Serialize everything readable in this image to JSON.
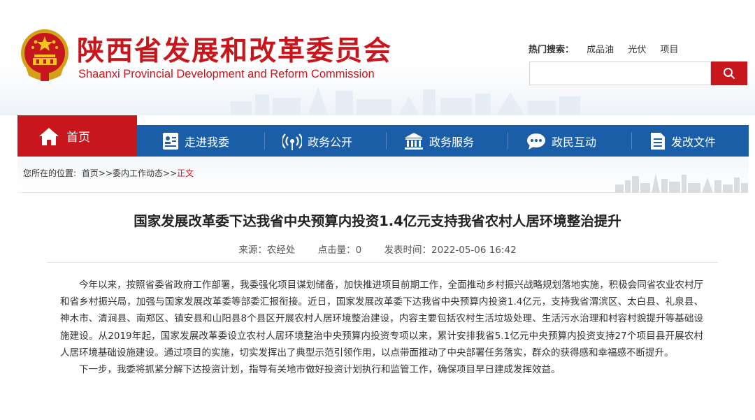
{
  "header": {
    "title_cn": "陕西省发展和改革委员会",
    "title_en": "Shaanxi Provincial Development and Reform Commission",
    "hot_search_label": "热门搜索：",
    "hot_search_items": [
      "成品油",
      "光伏",
      "项目"
    ],
    "search_placeholder": ""
  },
  "nav": {
    "home": "首页",
    "items": [
      "走进我委",
      "政务公开",
      "政务服务",
      "政民互动",
      "发改文件"
    ]
  },
  "breadcrumb": {
    "prefix": "您所在的位置:",
    "home": "首页",
    "sep1": ">>",
    "section": "委内工作动态",
    "sep2": ">>",
    "current": "正文"
  },
  "article": {
    "title": "国家发展改革委下达我省中央预算内投资1.4亿元支持我省农村人居环境整治提升",
    "source": "来源：农经处",
    "clicks": "点击量：0",
    "published": "发表时间：2022-05-06 16:42",
    "paragraphs": [
      "今年以来，按照省委省政府工作部署，我委强化项目谋划储备，加快推进项目前期工作，全面推动乡村振兴战略规划落地实施，积极会同省农业农村厅和省乡村振兴局，加强与国家发展改革委等部委汇报衔接。近日，国家发展改革委下达我省中央预算内投资1.4亿元，支持我省渭滨区、太白县、礼泉县、神木市、清涧县、南郑区、镇安县和山阳县8个县区开展农村人居环境整治建设，内容主要包括农村生活垃圾处理、生活污水治理和村容村貌提升等基础设施建设。从2019年起，国家发展改革委设立农村人居环境整治中央预算内投资专项以来，累计安排我省5.1亿元中央预算内投资支持27个项目县开展农村人居环境基础设施建设。通过项目的实施，切实发挥出了典型示范引领作用，以点带面推动了中央部署任务落实，群众的获得感和幸福感不断提升。",
      "下一步，我委将抓紧分解下达投资计划，指导有关地市做好投资计划执行和监管工作，确保项目早日建成发挥效益。"
    ]
  },
  "colors": {
    "brand_red": "#c8161d",
    "nav_blue": "#1b5ea8"
  },
  "icons": [
    "national-emblem-icon",
    "search-icon",
    "home-icon",
    "id-card-icon",
    "broadcast-icon",
    "government-building-icon",
    "chat-bubble-icon",
    "document-icon"
  ]
}
